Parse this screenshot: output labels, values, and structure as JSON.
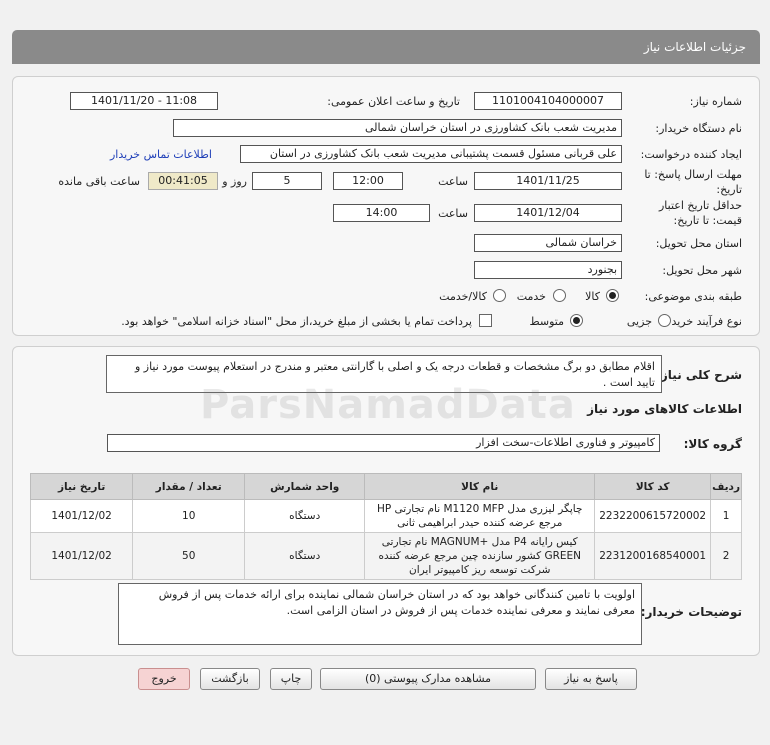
{
  "header": {
    "title": "جزئیات اطلاعات نیاز"
  },
  "form": {
    "need_number_label": "شماره نیاز:",
    "need_number": "1101004104000007",
    "announce_label": "تاریخ و ساعت اعلان عمومی:",
    "announce_value": "1401/11/20 - 11:08",
    "buyer_org_label": "نام دستگاه خریدار:",
    "buyer_org": "مدیریت شعب بانک کشاورزی در استان خراسان شمالی",
    "creator_label": "ایجاد کننده درخواست:",
    "creator": "علی  قربانی  مسئول قسمت پشتیبانی مدیریت شعب بانک کشاورزی در استان",
    "contact_link": "اطلاعات تماس خریدار",
    "deadline_label_1": "مهلت ارسال پاسخ: تا",
    "deadline_label_2": "تاریخ:",
    "deadline_date": "1401/11/25",
    "time_label": "ساعت",
    "deadline_time": "12:00",
    "days_value": "5",
    "days_label": "روز و",
    "remaining_time": "00:41:05",
    "remaining_label": "ساعت باقی مانده",
    "validity_label_1": "حداقل تاریخ اعتبار",
    "validity_label_2": "قیمت: تا تاریخ:",
    "validity_date": "1401/12/04",
    "validity_time": "14:00",
    "province_label": "استان محل تحویل:",
    "province": "خراسان شمالی",
    "city_label": "شهر محل تحویل:",
    "city": "بجنورد",
    "category_label": "طبقه بندی موضوعی:",
    "category_options": [
      "کالا",
      "خدمت",
      "کالا/خدمت"
    ],
    "process_label": "نوع فرآیند خرید :",
    "process_options": [
      "جزیی",
      "متوسط"
    ],
    "payment_note": "پرداخت تمام یا بخشی از مبلغ خرید،از محل \"اسناد خزانه اسلامی\" خواهد بود."
  },
  "description": {
    "label": "شرح کلی نیاز:",
    "text": "اقلام مطابق دو برگ مشخصات و قطعات درجه یک و اصلی با گارانتی معتبر و مندرج در استعلام پیوست  مورد نیاز و تایید است ."
  },
  "goods": {
    "title": "اطلاعات کالاهای مورد نیاز",
    "group_label": "گروه کالا:",
    "group_value": "کامپیوتر و فناوری اطلاعات-سخت افزار"
  },
  "table": {
    "headers": [
      "ردیف",
      "کد کالا",
      "نام کالا",
      "واحد شمارش",
      "تعداد / مقدار",
      "تاریخ نیاز"
    ],
    "rows": [
      {
        "idx": "1",
        "code": "2232200615720002",
        "name": "چاپگر لیزری مدل M1120 MFP نام تجارتی HP مرجع عرضه کننده حیدر ابراهیمی ثانی",
        "unit": "دستگاه",
        "qty": "10",
        "date": "1401/12/02"
      },
      {
        "idx": "2",
        "code": "2231200168540001",
        "name": "کیس رایانه P4 مدل +MAGNUM نام تجارتی GREEN کشور سازنده چین مرجع عرضه کننده شرکت توسعه ریز کامپیوتر ایران",
        "unit": "دستگاه",
        "qty": "50",
        "date": "1401/12/02"
      }
    ]
  },
  "buyer_notes": {
    "label": "توضیحات خریدار:",
    "text": "اولویت با تامین کنندگانی خواهد بود که در استان خراسان شمالی نماینده برای ارائه خدمات پس از فروش معرفی نمایند و معرفی نماینده خدمات پس از فروش در استان الزامی است."
  },
  "buttons": {
    "reply": "پاسخ به نیاز",
    "attachments": "مشاهده مدارک پیوستی (0)",
    "print": "چاپ",
    "back": "بازگشت",
    "exit": "خروج"
  },
  "watermark": "ParsNamadData",
  "colors": {
    "header_bg": "#8a8a8a",
    "link": "#1f3fb8",
    "remaining_bg": "#efe9c8",
    "exit_bg": "#f6d3d3"
  }
}
